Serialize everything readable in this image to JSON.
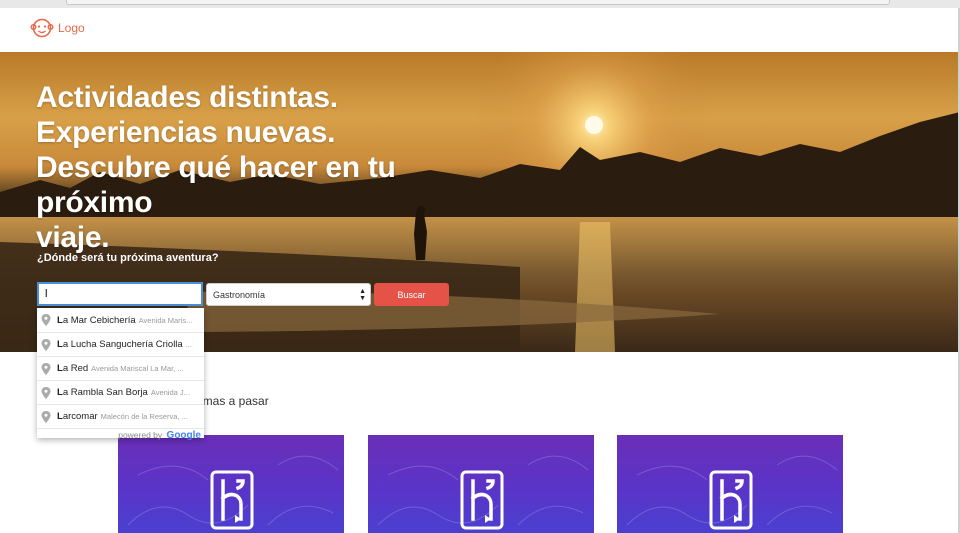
{
  "brand": {
    "logo_text": "Logo",
    "logo_icon": "monkey-face-icon",
    "accent": "#e8694a"
  },
  "hero": {
    "title_lines": [
      "Actividades distintas.",
      "Experiencias nuevas.",
      "Descubre qué hacer en tu próximo",
      "viaje."
    ],
    "question": "¿Dónde será tu próxima aventura?"
  },
  "search": {
    "input_value": "l",
    "category_selected": "Gastronomía",
    "button_label": "Buscar",
    "button_color": "#e55348",
    "focus_color": "#4a90d9"
  },
  "autocomplete": {
    "items": [
      {
        "match": "L",
        "rest": "a Mar Cebichería",
        "secondary": "Avenida Maris..."
      },
      {
        "match": "L",
        "rest": "a Lucha Sanguchería Criolla",
        "secondary": "..."
      },
      {
        "match": "L",
        "rest": "a Red",
        "secondary": "Avenida Mariscal La Mar, ..."
      },
      {
        "match": "L",
        "rest": "a Rambla San Borja",
        "secondary": "Avenida J..."
      },
      {
        "match": "L",
        "rest": "arcomar",
        "secondary": "Malecón de la Reserva, ..."
      }
    ],
    "footer_prefix": "powered by",
    "footer_brand": "Google"
  },
  "section": {
    "heading_visible": "imas a pasar"
  },
  "cards": [
    {
      "icon": "heroku-icon"
    },
    {
      "icon": "heroku-icon"
    },
    {
      "icon": "heroku-icon"
    }
  ]
}
